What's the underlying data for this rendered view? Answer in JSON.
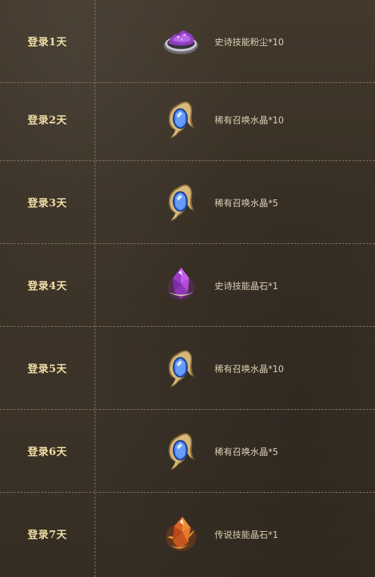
{
  "rows": [
    {
      "day": "登录1天",
      "reward": "史诗技能粉尘*10",
      "icon": "purple-dust-icon"
    },
    {
      "day": "登录2天",
      "reward": "稀有召唤水晶*10",
      "icon": "blue-summon-crystal-icon"
    },
    {
      "day": "登录3天",
      "reward": "稀有召唤水晶*5",
      "icon": "blue-summon-crystal-icon"
    },
    {
      "day": "登录4天",
      "reward": "史诗技能晶石*1",
      "icon": "purple-skill-crystal-icon"
    },
    {
      "day": "登录5天",
      "reward": "稀有召唤水晶*10",
      "icon": "blue-summon-crystal-icon"
    },
    {
      "day": "登录6天",
      "reward": "稀有召唤水晶*5",
      "icon": "blue-summon-crystal-icon"
    },
    {
      "day": "登录7天",
      "reward": "传说技能晶石*1",
      "icon": "orange-skill-crystal-icon"
    }
  ],
  "colors": {
    "background": "#3b3227",
    "day_text": "#f1dfa6",
    "reward_text": "#ddd0b5",
    "divider": "#8a7a62"
  }
}
